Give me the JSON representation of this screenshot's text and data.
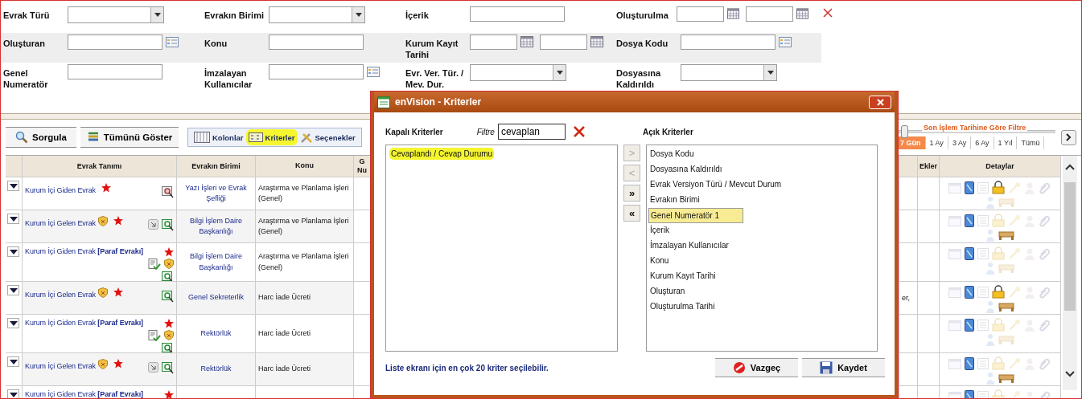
{
  "search_form": {
    "rows": [
      [
        {
          "label": "Evrak Türü",
          "kind": "select"
        },
        {
          "label": "Evrakın Birimi",
          "kind": "select"
        },
        {
          "label": "İçerik",
          "kind": "text"
        },
        {
          "label": "Oluşturulma",
          "kind": "date_range"
        }
      ],
      [
        {
          "label": "Oluşturan",
          "kind": "picker"
        },
        {
          "label": "Konu",
          "kind": "text"
        },
        {
          "label": "Kurum Kayıt Tarihi",
          "kind": "date_range"
        },
        {
          "label": "Dosya Kodu",
          "kind": "picker"
        }
      ],
      [
        {
          "label": "Genel Numeratör",
          "kind": "text"
        },
        {
          "label": "İmzalayan Kullanıcılar",
          "kind": "picker"
        },
        {
          "label": "Evr. Ver. Tür. / Mev. Dur.",
          "kind": "select"
        },
        {
          "label": "Dosyasına Kaldırıldı",
          "kind": "select"
        }
      ]
    ]
  },
  "toolbar": {
    "buttons": [
      {
        "label": "Sorgula",
        "kind": "search"
      },
      {
        "label": "Tümünü Göster",
        "kind": "all"
      }
    ],
    "tools": [
      {
        "label": "Kolonlar",
        "kind": "columns",
        "highlighted": false
      },
      {
        "label": "Kriterler",
        "kind": "criteria",
        "highlighted": true
      },
      {
        "label": "Seçenekler",
        "kind": "options",
        "highlighted": false
      }
    ]
  },
  "date_filter": {
    "label": "Son İşlem Tarihine Göre Filtre",
    "level": 0.02,
    "tabs": [
      {
        "label": "7 Gün",
        "selected": true
      },
      {
        "label": "1 Ay",
        "selected": false
      },
      {
        "label": "3 Ay",
        "selected": false
      },
      {
        "label": "6 Ay",
        "selected": false
      },
      {
        "label": "1 Yıl",
        "selected": false
      },
      {
        "label": "Tümü",
        "selected": false
      }
    ]
  },
  "table": {
    "columns": {
      "evrak": "Evrak Tanımı",
      "birim": "Evrakın Birimi",
      "konu": "Konu",
      "column_5": "G Nu",
      "ekler": "Ekler",
      "detaylar": "Detaylar"
    },
    "rows": [
      {
        "title": "Kurum İçi Giden Evrak",
        "kind": "standard",
        "shield": false,
        "star": true,
        "forward": false,
        "preview_active": false,
        "unit": "Yazı İşleri ve Evrak Şefliği",
        "subject": "Araştırma ve Planlama İşleri (Genel)",
        "lock": true,
        "furniture": false
      },
      {
        "title": "Kurum İçi Gelen Evrak",
        "kind": "standard",
        "shield": true,
        "star": true,
        "forward": true,
        "preview_active": true,
        "unit": "Bilgi İşlem Daire Başkanlığı",
        "subject": "Araştırma ve Planlama İşleri (Genel)",
        "lock": false,
        "furniture": true
      },
      {
        "title": "Kurum İçi Giden Evrak **[Paraf Evrakı]**",
        "kind": "paraf",
        "shield": true,
        "star": true,
        "forward": false,
        "preview_active": true,
        "unit": "Bilgi İşlem Daire Başkanlığı",
        "subject": "Araştırma ve Planlama İşleri (Genel)",
        "lock": false,
        "furniture": false
      },
      {
        "title": "Kurum İçi Gelen Evrak",
        "kind": "standard",
        "shield": true,
        "star": true,
        "forward": false,
        "preview_active": true,
        "unit": "Genel Sekreterlik",
        "subject": "Harc İade Ücreti",
        "column_6": "er,",
        "lock": true,
        "furniture": true
      },
      {
        "title": "Kurum İçi Giden Evrak **[Paraf Evrakı]**",
        "kind": "paraf",
        "shield": true,
        "star": true,
        "forward": false,
        "preview_active": true,
        "unit": "Rektörlük",
        "subject": "Harc İade Ücreti",
        "lock": false,
        "furniture": false
      },
      {
        "title": "Kurum İçi Gelen Evrak",
        "kind": "standard",
        "shield": true,
        "star": true,
        "forward": true,
        "preview_active": true,
        "unit": "Rektörlük",
        "subject": "Harc İade Ücreti",
        "lock": false,
        "furniture": true
      },
      {
        "title": "Kurum İçi Giden Evrak **[Paraf Evrakı]**",
        "kind": "cut",
        "shield": false,
        "star": true,
        "forward": false,
        "lock": false
      }
    ]
  },
  "dialog": {
    "title": "enVision - Kriterler",
    "closed_label": "Kapalı Kriterler",
    "filter_label": "Filtre",
    "filter_value": "cevaplan",
    "open_label": "Açık Kriterler",
    "closed_items": [
      {
        "label": "Cevaplandı / Cevap Durumu",
        "highlighted": true,
        "selected": false
      }
    ],
    "move_buttons": [
      {
        "label": ">",
        "disabled": true
      },
      {
        "label": "<",
        "disabled": true
      },
      {
        "label": "»",
        "disabled": false
      },
      {
        "label": "«",
        "disabled": false
      }
    ],
    "open_items": [
      {
        "label": "Dosya Kodu",
        "selected": false
      },
      {
        "label": "Dosyasına Kaldırıldı",
        "selected": false
      },
      {
        "label": "Evrak Versiyon Türü / Mevcut Durum",
        "selected": false
      },
      {
        "label": "Evrakın Birimi",
        "selected": false
      },
      {
        "label": "Genel Numeratör 1",
        "selected": true
      },
      {
        "label": "İçerik",
        "selected": false
      },
      {
        "label": "İmzalayan Kullanıcılar",
        "selected": false
      },
      {
        "label": "Konu",
        "selected": false
      },
      {
        "label": "Kurum Kayıt Tarihi",
        "selected": false
      },
      {
        "label": "Oluşturan",
        "selected": false
      },
      {
        "label": "Oluşturulma Tarihi",
        "selected": false
      }
    ],
    "note": "Liste ekranı için en çok 20 kriter seçilebilir.",
    "buttons": [
      {
        "label": "Vazgeç",
        "kind": "cancel"
      },
      {
        "label": "Kaydet",
        "kind": "save"
      }
    ]
  }
}
